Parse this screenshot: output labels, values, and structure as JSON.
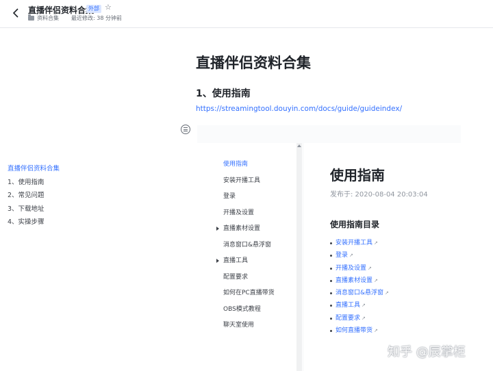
{
  "header": {
    "title": "直播伴侣资料合集",
    "badge": "外部",
    "folder": "资料合集",
    "modified": "最近修改: 38 分钟前"
  },
  "toc": {
    "items": [
      {
        "label": "直播伴侣资料合集",
        "active": true
      },
      {
        "label": "1、使用指南",
        "active": false
      },
      {
        "label": "2、常见问题",
        "active": false
      },
      {
        "label": "3、下载地址",
        "active": false
      },
      {
        "label": "4、实操步骤",
        "active": false
      }
    ]
  },
  "doc": {
    "title": "直播伴侣资料合集",
    "section": "1、使用指南",
    "link": "https://streamingtool.douyin.com/docs/guide/guideindex/"
  },
  "embed": {
    "nav": [
      {
        "label": "使用指南",
        "active": true,
        "expandable": false
      },
      {
        "label": "安装开播工具",
        "active": false,
        "expandable": false
      },
      {
        "label": "登录",
        "active": false,
        "expandable": false
      },
      {
        "label": "开播及设置",
        "active": false,
        "expandable": false
      },
      {
        "label": "直播素材设置",
        "active": false,
        "expandable": true
      },
      {
        "label": "消息窗口&悬浮窗",
        "active": false,
        "expandable": false
      },
      {
        "label": "直播工具",
        "active": false,
        "expandable": true
      },
      {
        "label": "配置要求",
        "active": false,
        "expandable": false
      },
      {
        "label": "如何在PC直播带货",
        "active": false,
        "expandable": false
      },
      {
        "label": "OBS模式教程",
        "active": false,
        "expandable": false
      },
      {
        "label": "聊天室使用",
        "active": false,
        "expandable": false
      }
    ],
    "heading": "使用指南",
    "date": "发布于: 2020-08-04 20:03:04",
    "subheading": "使用指南目录",
    "list": [
      "安装开播工具",
      "登录",
      "开播及设置",
      "直播素材设置",
      "消息窗口&悬浮窗",
      "直播工具",
      "配置要求",
      "如何直播带货"
    ]
  },
  "watermark": "知乎 @辰掌柜",
  "colors": {
    "accent": "#3370ff",
    "text": "#1f2329",
    "muted": "#646a73"
  }
}
